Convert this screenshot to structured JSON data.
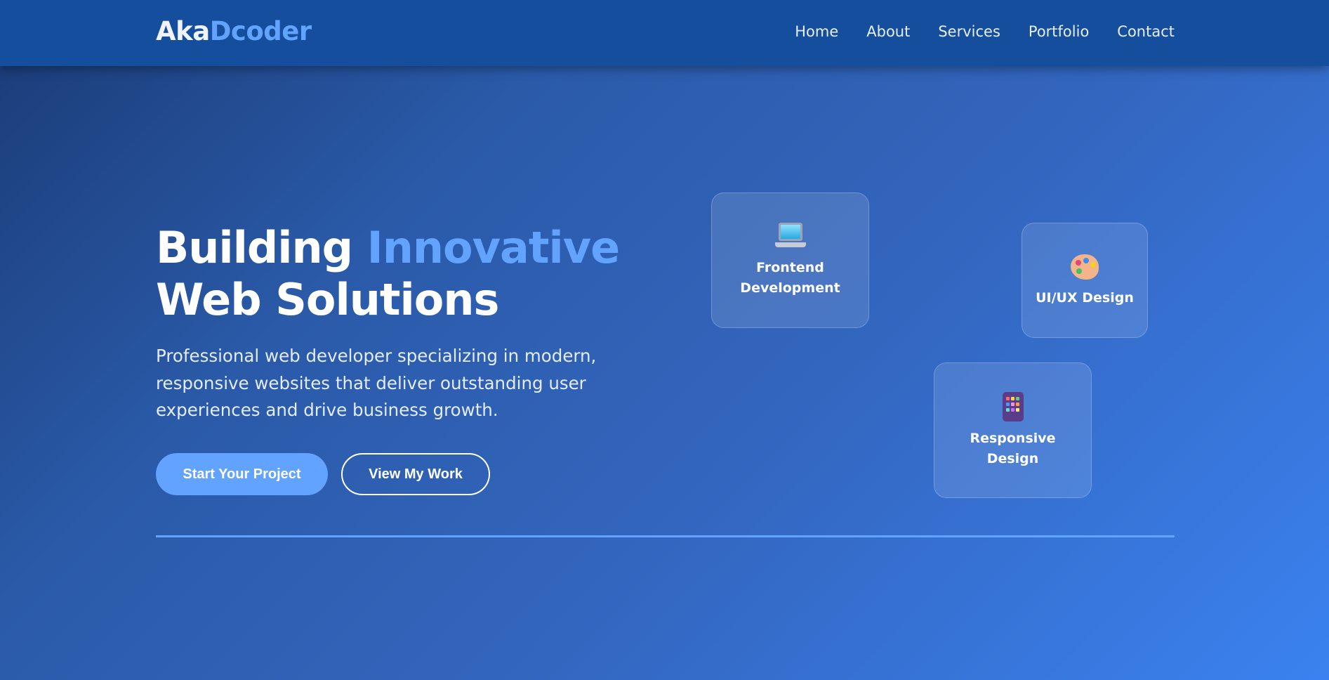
{
  "header": {
    "logo_part1": "Aka",
    "logo_part2": "Dcoder",
    "nav": [
      "Home",
      "About",
      "Services",
      "Portfolio",
      "Contact"
    ]
  },
  "hero": {
    "title_part1": "Building ",
    "title_accent": "Innovative",
    "title_line2": "Web Solutions",
    "description": "Professional web developer specializing in modern, responsive websites that deliver outstanding user experiences and drive business growth.",
    "primary_button": "Start Your Project",
    "secondary_button": "View My Work"
  },
  "cards": [
    {
      "label": "Frontend Development",
      "icon": "laptop-icon"
    },
    {
      "label": "UI/UX Design",
      "icon": "palette-icon"
    },
    {
      "label": "Responsive Design",
      "icon": "mobile-phone-icon"
    }
  ],
  "colors": {
    "accent": "#62a3ff",
    "navbar": "#154e9c",
    "background_start": "#1a3a75",
    "background_end": "#3b82f0"
  }
}
